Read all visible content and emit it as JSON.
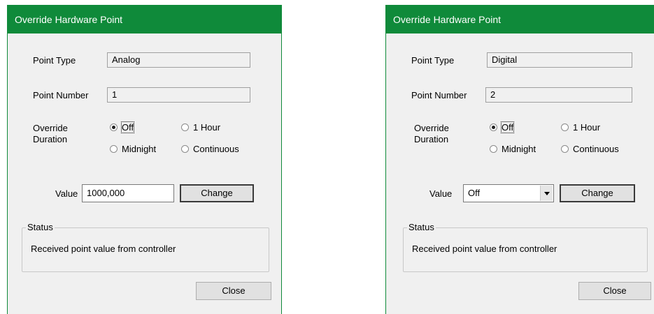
{
  "dialogs": [
    {
      "title": "Override Hardware Point",
      "point_type_label": "Point Type",
      "point_type_value": "Analog",
      "point_number_label": "Point Number",
      "point_number_value": "1",
      "override_label_1": "Override",
      "override_label_2": "Duration",
      "radio_off": "Off",
      "radio_1hour": "1 Hour",
      "radio_midnight": "Midnight",
      "radio_continuous": "Continuous",
      "selected_duration": "Off",
      "value_label": "Value",
      "value_text": "1000,000",
      "change_label": "Change",
      "status_title": "Status",
      "status_text": "Received point value from controller",
      "close_label": "Close"
    },
    {
      "title": "Override Hardware Point",
      "point_type_label": "Point Type",
      "point_type_value": "Digital",
      "point_number_label": "Point Number",
      "point_number_value": "2",
      "override_label_1": "Override",
      "override_label_2": "Duration",
      "radio_off": "Off",
      "radio_1hour": "1 Hour",
      "radio_midnight": "Midnight",
      "radio_continuous": "Continuous",
      "selected_duration": "Off",
      "value_label": "Value",
      "value_selected": "Off",
      "change_label": "Change",
      "status_title": "Status",
      "status_text": "Received point value from controller",
      "close_label": "Close"
    }
  ],
  "colors": {
    "titlebar": "#0f8a3a",
    "dialog_bg": "#f0f0f0"
  }
}
